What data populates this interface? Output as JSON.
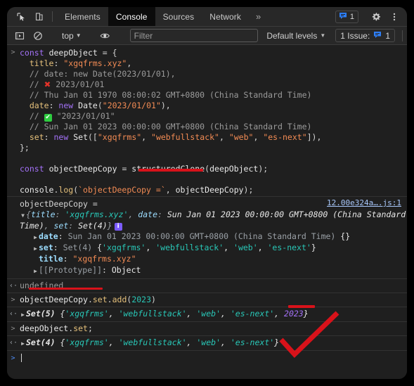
{
  "window": {
    "background": "#000000",
    "panel_bg": "#282828",
    "console_bg": "#1f1f1f"
  },
  "tabbar": {
    "icons": [
      {
        "name": "inspect-element-icon",
        "title": "Inspect element"
      },
      {
        "name": "device-toolbar-icon",
        "title": "Toggle device toolbar"
      }
    ],
    "tabs": [
      {
        "label": "Elements",
        "selected": false
      },
      {
        "label": "Console",
        "selected": true
      },
      {
        "label": "Sources",
        "selected": false
      },
      {
        "label": "Network",
        "selected": false
      }
    ],
    "more_tabs_label": "»",
    "issue_count": "1",
    "settings_label": "Settings",
    "more_options_label": "More options"
  },
  "filterbar": {
    "sidebar_toggle": "Show console sidebar",
    "clear_console": "Clear console",
    "context": "top",
    "eye_title": "Create live expression",
    "filter_placeholder": "Filter",
    "filter_value": "",
    "levels_label": "Default levels",
    "issues_label": "1 Issue:",
    "issues_count": "1"
  },
  "console": {
    "messages": [
      {
        "type": "input",
        "gutter": ">",
        "lines": [
          "const deepObject = {",
          "  title: \"xgqfrms.xyz\",",
          "  // date: new Date(2023/01/01),",
          "  // ❌ 2023/01/01",
          "  // Thu Jan 01 1970 08:00:02 GMT+0800 (China Standard Time)",
          "  date: new Date(\"2023/01/01\"),",
          "  // ✅ \"2023/01/01\"",
          "  // Sun Jan 01 2023 00:00:00 GMT+0800 (China Standard Time)",
          "  set: new Set([\"xgqfrms\", \"webfullstack\", \"web\", \"es-next\"]),",
          "};",
          "",
          "const objectDeepCopy = structuredClone(deepObject);",
          "",
          "console.log(`objectDeepCopy =`, objectDeepCopy);"
        ]
      },
      {
        "type": "log",
        "gutter": "",
        "label": "objectDeepCopy =",
        "source_link": "12.00e324a….js:1",
        "preview": "{title: 'xgqfrms.xyz', date: Sun Jan 01 2023 00:00:00 GMT+0800 (China Standard Time), set: Set(4)}",
        "info_badge": "i",
        "properties": [
          {
            "key": "date",
            "value": "Sun Jan 01 2023 00:00:00 GMT+0800 (China Standard Time) {}",
            "expandable": true
          },
          {
            "key": "set",
            "value": "Set(4) {'xgqfrms', 'webfullstack', 'web', 'es-next'}",
            "expandable": true
          },
          {
            "key": "title",
            "value": "\"xgqfrms.xyz\"",
            "expandable": false
          },
          {
            "key": "[[Prototype]]",
            "value": "Object",
            "expandable": true
          }
        ]
      },
      {
        "type": "result",
        "gutter": "‹·",
        "text": "undefined"
      },
      {
        "type": "input",
        "gutter": ">",
        "text": "objectDeepCopy.set.add(2023)"
      },
      {
        "type": "result",
        "gutter": "‹·",
        "text": "Set(5) {'xgqfrms', 'webfullstack', 'web', 'es-next', 2023}"
      },
      {
        "type": "input",
        "gutter": ">",
        "text": "deepObject.set;"
      },
      {
        "type": "result",
        "gutter": "‹·",
        "text": "Set(4) {'xgqfrms', 'webfullstack', 'web', 'es-next'}"
      },
      {
        "type": "prompt",
        "gutter": ">",
        "text": ""
      }
    ]
  },
  "annotations": {
    "color": "#d8121a",
    "underlines": [
      {
        "name": "underline-structuredclone",
        "target": "structuredClone"
      },
      {
        "name": "underline-objectdeepcopy-set",
        "target": "objectDeepCopy.set"
      },
      {
        "name": "underline-2023",
        "target": "2023"
      }
    ],
    "checkmark": {
      "name": "red-checkmark",
      "meaning": "correct"
    }
  }
}
